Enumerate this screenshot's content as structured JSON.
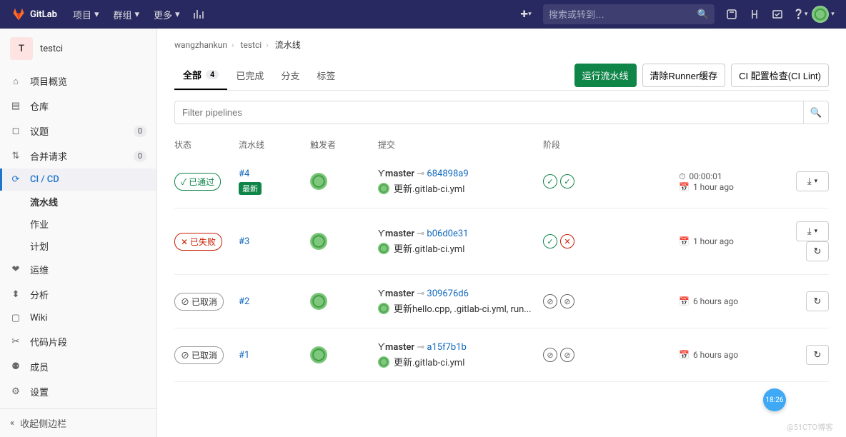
{
  "brand": "GitLab",
  "nav": {
    "projects": "项目",
    "groups": "群组",
    "more": "更多",
    "search_placeholder": "搜索或转到…"
  },
  "project": {
    "initial": "T",
    "name": "testci"
  },
  "sidebar": {
    "items": [
      {
        "icon": "home",
        "label": "项目概览"
      },
      {
        "icon": "repo",
        "label": "仓库"
      },
      {
        "icon": "issues",
        "label": "议题",
        "count": "0"
      },
      {
        "icon": "mr",
        "label": "合并请求",
        "count": "0"
      },
      {
        "icon": "cicd",
        "label": "CI / CD",
        "active": true
      },
      {
        "icon": "ops",
        "label": "运维"
      },
      {
        "icon": "analytics",
        "label": "分析"
      },
      {
        "icon": "wiki",
        "label": "Wiki"
      },
      {
        "icon": "snippets",
        "label": "代码片段"
      },
      {
        "icon": "members",
        "label": "成员"
      },
      {
        "icon": "settings",
        "label": "设置"
      }
    ],
    "sub": [
      "流水线",
      "作业",
      "计划"
    ],
    "collapse": "收起侧边栏"
  },
  "breadcrumb": {
    "owner": "wangzhankun",
    "project": "testci",
    "page": "流水线"
  },
  "tabs": {
    "all": "全部",
    "all_count": "4",
    "finished": "已完成",
    "branches": "分支",
    "tags": "标签"
  },
  "actions": {
    "run": "运行流水线",
    "clear_cache": "清除Runner缓存",
    "ci_lint": "CI 配置检查(CI Lint)"
  },
  "filter_placeholder": "Filter pipelines",
  "columns": {
    "status": "状态",
    "pipeline": "流水线",
    "trigger": "触发者",
    "commit": "提交",
    "stages": "阶段"
  },
  "branch": "master",
  "latest_tag": "最新",
  "status_labels": {
    "passed": "已通过",
    "failed": "已失败",
    "canceled": "已取消"
  },
  "pipelines": [
    {
      "status": "passed",
      "id": "#4",
      "latest": true,
      "commit": "684898a9",
      "msg": "更新.gitlab-ci.yml",
      "stages": [
        "pass",
        "pass"
      ],
      "duration": "00:00:01",
      "time": "1 hour ago",
      "actions": [
        "download"
      ]
    },
    {
      "status": "failed",
      "id": "#3",
      "commit": "b06d0e31",
      "msg": "更新.gitlab-ci.yml",
      "stages": [
        "pass",
        "fail"
      ],
      "time": "1 hour ago",
      "actions": [
        "download",
        "retry"
      ]
    },
    {
      "status": "canceled",
      "id": "#2",
      "commit": "309676d6",
      "msg": "更新hello.cpp, .gitlab-ci.yml, run...",
      "stages": [
        "cancel",
        "cancel"
      ],
      "time": "6 hours ago",
      "actions": [
        "retry"
      ]
    },
    {
      "status": "canceled",
      "id": "#1",
      "commit": "a15f7b1b",
      "msg": "更新.gitlab-ci.yml",
      "stages": [
        "cancel",
        "cancel"
      ],
      "time": "6 hours ago",
      "actions": [
        "retry"
      ]
    }
  ],
  "float_time": "18:26",
  "watermark": "@51CTO博客"
}
